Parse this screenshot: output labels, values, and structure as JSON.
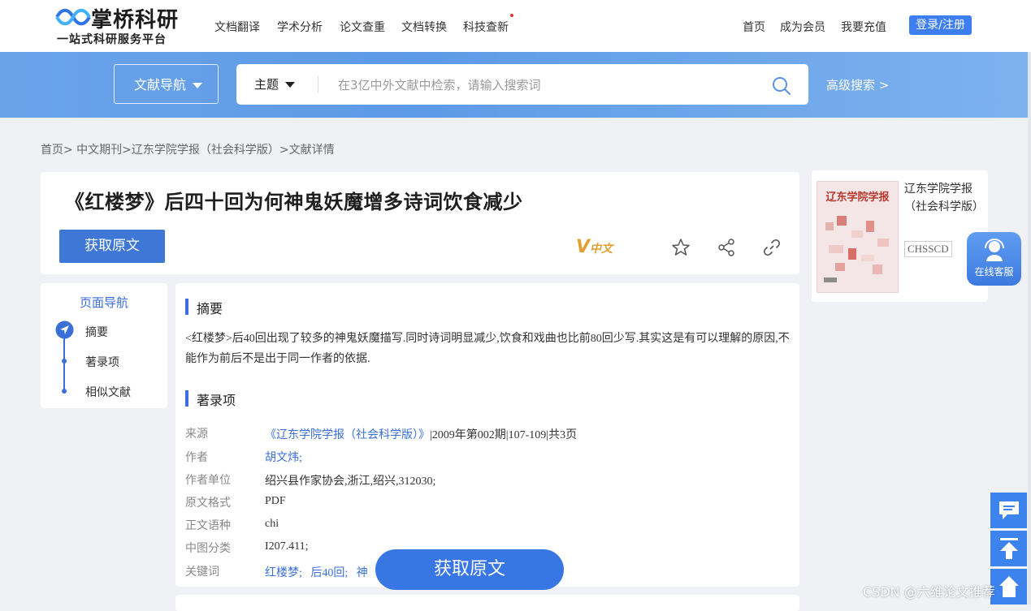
{
  "header": {
    "logo_main": "掌桥科研",
    "logo_sub": "一站式科研服务平台",
    "nav": [
      "文档翻译",
      "学术分析",
      "论文查重",
      "文档转换",
      "科技查新"
    ],
    "right_nav": [
      "首页",
      "成为会员",
      "我要充值"
    ],
    "login": "登录/注册"
  },
  "banner": {
    "nav_dropdown": "文献导航",
    "search_category": "主题",
    "search_placeholder": "在3亿中外文献中检索，请输入搜索词",
    "advanced": "高级搜索 >"
  },
  "breadcrumb": "首页> 中文期刊>辽东学院学报（社会科学版）>文献详情",
  "doc": {
    "title": "《红楼梦》后四十回为何神鬼妖魔增多诗词饮食减少",
    "get_btn": "获取原文",
    "lang_badge_v": "V",
    "lang_badge": "中文"
  },
  "journal": {
    "cover_title": "辽东学院学报",
    "name": "辽东学院学报（社会科学版）",
    "badge": "CHSSCD"
  },
  "online_service": "在线客服",
  "side_nav": {
    "title": "页面导航",
    "items": [
      "摘要",
      "著录项",
      "相似文献"
    ]
  },
  "abstract": {
    "heading": "摘要",
    "text": "<红楼梦>后40回出现了较多的神鬼妖魔描写.同时诗词明显减少,饮食和戏曲也比前80回少写.其实这是有可以理解的原因,不能作为前后不是出于同一作者的依据."
  },
  "record": {
    "heading": "著录项",
    "source_label": "来源",
    "source_link": "《辽东学院学报（社会科学版）》",
    "source_rest": "|2009年第002期|107-109|共3页",
    "author_label": "作者",
    "author": "胡文炜;",
    "org_label": "作者单位",
    "org": "绍兴县作家协会,浙江,绍兴,312030;",
    "format_label": "原文格式",
    "format": "PDF",
    "lang_label": "正文语种",
    "lang": "chi",
    "clc_label": "中图分类",
    "clc": "I207.411;",
    "kw_label": "关键词",
    "keywords": [
      "红楼梦;",
      "后40回;",
      "神"
    ]
  },
  "float_btn": "获取原文",
  "watermark": "CSDN @六维论文推荐",
  "colors": {
    "accent": "#3d7ef0",
    "banner": "#6aa3e8"
  }
}
